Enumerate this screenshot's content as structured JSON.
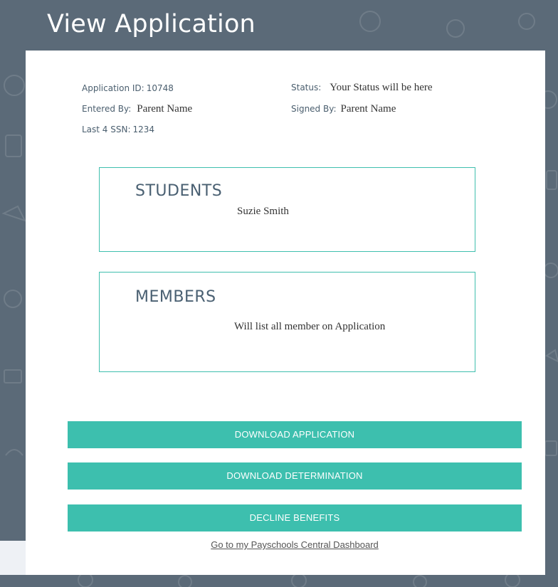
{
  "page": {
    "title": "View Application"
  },
  "application": {
    "id_label": "Application ID:",
    "id_value": "10748",
    "entered_by_label": "Entered By:",
    "entered_by_value": "Parent Name",
    "ssn_label": "Last 4 SSN:",
    "ssn_value": "1234",
    "status_label": "Status:",
    "status_value": "Your Status will be here",
    "signed_by_label": "Signed By:",
    "signed_by_value": "Parent Name"
  },
  "students": {
    "heading": "STUDENTS",
    "names": [
      "Suzie Smith"
    ]
  },
  "members": {
    "heading": "MEMBERS",
    "text": "Will list all member on Application"
  },
  "actions": {
    "download_application": "DOWNLOAD APPLICATION",
    "download_determination": "DOWNLOAD DETERMINATION",
    "decline_benefits": "DECLINE BENEFITS",
    "dashboard_link": "Go to my Payschools Central Dashboard"
  },
  "colors": {
    "background": "#5b6a78",
    "accent": "#3dbfae",
    "heading": "#4a6072"
  }
}
